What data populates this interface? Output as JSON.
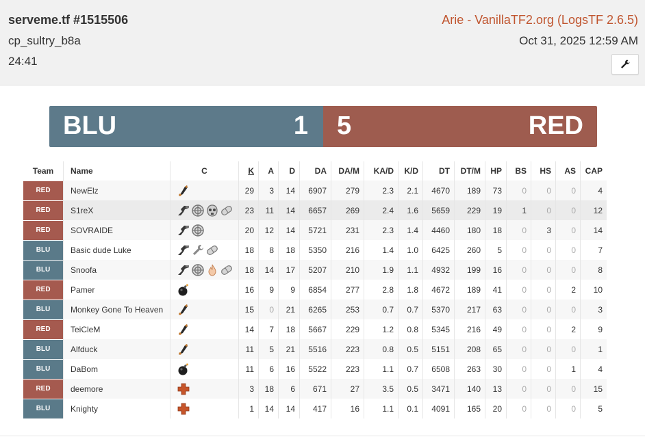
{
  "header": {
    "title": "serveme.tf #1515506",
    "map": "cp_sultry_b8a",
    "duration": "24:41",
    "uploader": "Arie - VanillaTF2.org (LogsTF 2.6.5)",
    "date": "Oct 31, 2025 12:59 AM",
    "tools_icon": "wrench-icon"
  },
  "score": {
    "blu_name": "BLU",
    "blu_score": "1",
    "red_score": "5",
    "red_name": "RED"
  },
  "table": {
    "columns": [
      "Team",
      "Name",
      "C",
      "K",
      "A",
      "D",
      "DA",
      "DA/M",
      "KA/D",
      "K/D",
      "DT",
      "DT/M",
      "HP",
      "BS",
      "HS",
      "AS",
      "CAP"
    ],
    "sorted_column": "K",
    "colors": {
      "RED": "#a55a4f",
      "BLU": "#5a7a89"
    },
    "rows": [
      {
        "team": "RED",
        "name": "NewElz",
        "classes": [
          "scout"
        ],
        "k": "29",
        "a": "3",
        "d": "14",
        "da": "6907",
        "dam": "279",
        "kad": "2.3",
        "kd": "2.1",
        "dt": "4670",
        "dtm": "189",
        "hp": "73",
        "bs": "0",
        "hs": "0",
        "as": "0",
        "cap": "4"
      },
      {
        "team": "RED",
        "name": "S1reX",
        "classes": [
          "soldier",
          "engineer",
          "pyro",
          "medic"
        ],
        "k": "23",
        "a": "11",
        "d": "14",
        "da": "6657",
        "dam": "269",
        "kad": "2.4",
        "kd": "1.6",
        "dt": "5659",
        "dtm": "229",
        "hp": "19",
        "bs": "1",
        "hs": "0",
        "as": "0",
        "cap": "12"
      },
      {
        "team": "RED",
        "name": "SOVRAIDE",
        "classes": [
          "soldier",
          "engineer"
        ],
        "k": "20",
        "a": "12",
        "d": "14",
        "da": "5721",
        "dam": "231",
        "kad": "2.3",
        "kd": "1.4",
        "dt": "4460",
        "dtm": "180",
        "hp": "18",
        "bs": "0",
        "hs": "3",
        "as": "0",
        "cap": "14"
      },
      {
        "team": "BLU",
        "name": "Basic dude Luke",
        "classes": [
          "soldier",
          "wrench",
          "medic"
        ],
        "k": "18",
        "a": "8",
        "d": "18",
        "da": "5350",
        "dam": "216",
        "kad": "1.4",
        "kd": "1.0",
        "dt": "6425",
        "dtm": "260",
        "hp": "5",
        "bs": "0",
        "hs": "0",
        "as": "0",
        "cap": "7"
      },
      {
        "team": "BLU",
        "name": "Snoofa",
        "classes": [
          "soldier",
          "engineer",
          "flame",
          "medic"
        ],
        "k": "18",
        "a": "14",
        "d": "17",
        "da": "5207",
        "dam": "210",
        "kad": "1.9",
        "kd": "1.1",
        "dt": "4932",
        "dtm": "199",
        "hp": "16",
        "bs": "0",
        "hs": "0",
        "as": "0",
        "cap": "8"
      },
      {
        "team": "RED",
        "name": "Pamer",
        "classes": [
          "demoman"
        ],
        "k": "16",
        "a": "9",
        "d": "9",
        "da": "6854",
        "dam": "277",
        "kad": "2.8",
        "kd": "1.8",
        "dt": "4672",
        "dtm": "189",
        "hp": "41",
        "bs": "0",
        "hs": "0",
        "as": "2",
        "cap": "10"
      },
      {
        "team": "BLU",
        "name": "Monkey Gone To Heaven",
        "classes": [
          "scout"
        ],
        "k": "15",
        "a": "0",
        "d": "21",
        "da": "6265",
        "dam": "253",
        "kad": "0.7",
        "kd": "0.7",
        "dt": "5370",
        "dtm": "217",
        "hp": "63",
        "bs": "0",
        "hs": "0",
        "as": "0",
        "cap": "3"
      },
      {
        "team": "RED",
        "name": "TeiCleM",
        "classes": [
          "scout"
        ],
        "k": "14",
        "a": "7",
        "d": "18",
        "da": "5667",
        "dam": "229",
        "kad": "1.2",
        "kd": "0.8",
        "dt": "5345",
        "dtm": "216",
        "hp": "49",
        "bs": "0",
        "hs": "0",
        "as": "2",
        "cap": "9"
      },
      {
        "team": "BLU",
        "name": "Alfduck",
        "classes": [
          "scout"
        ],
        "k": "11",
        "a": "5",
        "d": "21",
        "da": "5516",
        "dam": "223",
        "kad": "0.8",
        "kd": "0.5",
        "dt": "5151",
        "dtm": "208",
        "hp": "65",
        "bs": "0",
        "hs": "0",
        "as": "0",
        "cap": "1"
      },
      {
        "team": "BLU",
        "name": "DaBom",
        "classes": [
          "demoman"
        ],
        "k": "11",
        "a": "6",
        "d": "16",
        "da": "5522",
        "dam": "223",
        "kad": "1.1",
        "kd": "0.7",
        "dt": "6508",
        "dtm": "263",
        "hp": "30",
        "bs": "0",
        "hs": "0",
        "as": "1",
        "cap": "4"
      },
      {
        "team": "RED",
        "name": "deemore",
        "classes": [
          "medic_cross"
        ],
        "k": "3",
        "a": "18",
        "d": "6",
        "da": "671",
        "dam": "27",
        "kad": "3.5",
        "kd": "0.5",
        "dt": "3471",
        "dtm": "140",
        "hp": "13",
        "bs": "0",
        "hs": "0",
        "as": "0",
        "cap": "15"
      },
      {
        "team": "BLU",
        "name": "Knighty",
        "classes": [
          "medic_cross"
        ],
        "k": "1",
        "a": "14",
        "d": "14",
        "da": "417",
        "dam": "16",
        "kad": "1.1",
        "kd": "0.1",
        "dt": "4091",
        "dtm": "165",
        "hp": "20",
        "bs": "0",
        "hs": "0",
        "as": "0",
        "cap": "5"
      }
    ]
  }
}
